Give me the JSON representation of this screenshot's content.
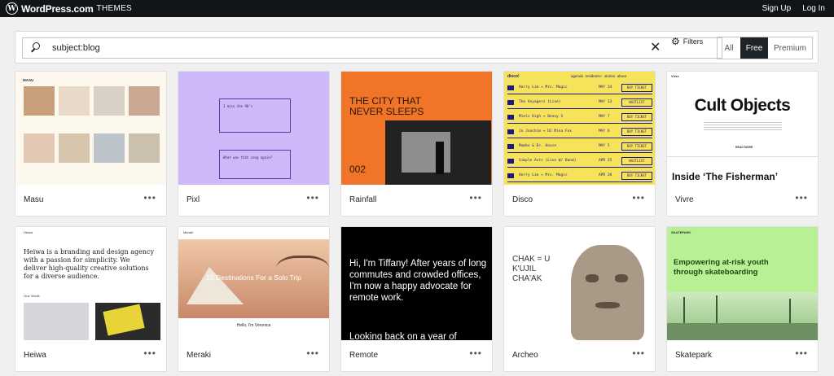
{
  "header": {
    "logo_letter": "W",
    "brand": "WordPress.com",
    "section": "THEMES",
    "signup": "Sign Up",
    "login": "Log In"
  },
  "search": {
    "query": "subject:blog",
    "clear_glyph": "✕",
    "filters_label": "Filters",
    "tabs": [
      "All",
      "Free",
      "Premium"
    ],
    "active_tab": "Free"
  },
  "themes": [
    {
      "name": "Masu",
      "menu": "•••"
    },
    {
      "name": "Pixl",
      "menu": "•••"
    },
    {
      "name": "Rainfall",
      "menu": "•••"
    },
    {
      "name": "Disco",
      "menu": "•••"
    },
    {
      "name": "Vivre",
      "menu": "•••"
    },
    {
      "name": "Heiwa",
      "menu": "•••"
    },
    {
      "name": "Meraki",
      "menu": "•••"
    },
    {
      "name": "Remote",
      "menu": "•••"
    },
    {
      "name": "Archeo",
      "menu": "•••"
    },
    {
      "name": "Skatepark",
      "menu": "•••"
    }
  ],
  "previews": {
    "masu": {
      "site": "MASU"
    },
    "pixl": {
      "post1": "I miss the 90's",
      "post2": "What was that song again?"
    },
    "rainfall": {
      "headline": "THE CITY THAT NEVER SLEEPS",
      "number": "002"
    },
    "disco": {
      "brand": "disco!",
      "nav": "agenda  residents+  stories  about",
      "rows": [
        {
          "act": "Horry Lim + Mrs. Magic",
          "date": "MAY 14",
          "btn": "BUY TICKET"
        },
        {
          "act": "The Voyagers (Live)",
          "date": "MAY 13",
          "btn": "WAITLIST"
        },
        {
          "act": "Miels High + Benny S",
          "date": "MAY 7",
          "btn": "BUY TICKET"
        },
        {
          "act": "Jo Joachim + DJ Mina Fox",
          "date": "MAY 6",
          "btn": "BUY TICKET"
        },
        {
          "act": "Mambo & Dr. House",
          "date": "MAY 5",
          "btn": "BUY TICKET"
        },
        {
          "act": "Simple Acts (Live W/ Band)",
          "date": "APR 25",
          "btn": "WAITLIST"
        },
        {
          "act": "Horry Lim + Mrs. Magic",
          "date": "APR 20",
          "btn": "BUY TICKET"
        }
      ]
    },
    "vivre": {
      "site": "Vivre",
      "headline": "Cult Objects",
      "sub": "Inside ‘The Fisherman’",
      "cta": "READ MORE"
    },
    "heiwa": {
      "site": "Heiwa",
      "intro": "Heiwa is a branding and design agency with a passion for simplicity. We deliver high-quality creative solutions for a diverse audience.",
      "section": "Our Work"
    },
    "meraki": {
      "site": "Meraki",
      "headline": "10 Destinations For a Solo Trip",
      "greeting": "Hello, I'm Veronica"
    },
    "remote": {
      "intro": "Hi, I'm Tiffany! After years of long commutes and crowded offices, I'm now a happy advocate for remote work.",
      "next": "Looking back on a year of"
    },
    "archeo": {
      "headline": "CHAK = U K'UJIL CHA'AK"
    },
    "skatepark": {
      "site": "SKATEPARK",
      "headline": "Empowering at-risk youth through skateboarding"
    }
  }
}
